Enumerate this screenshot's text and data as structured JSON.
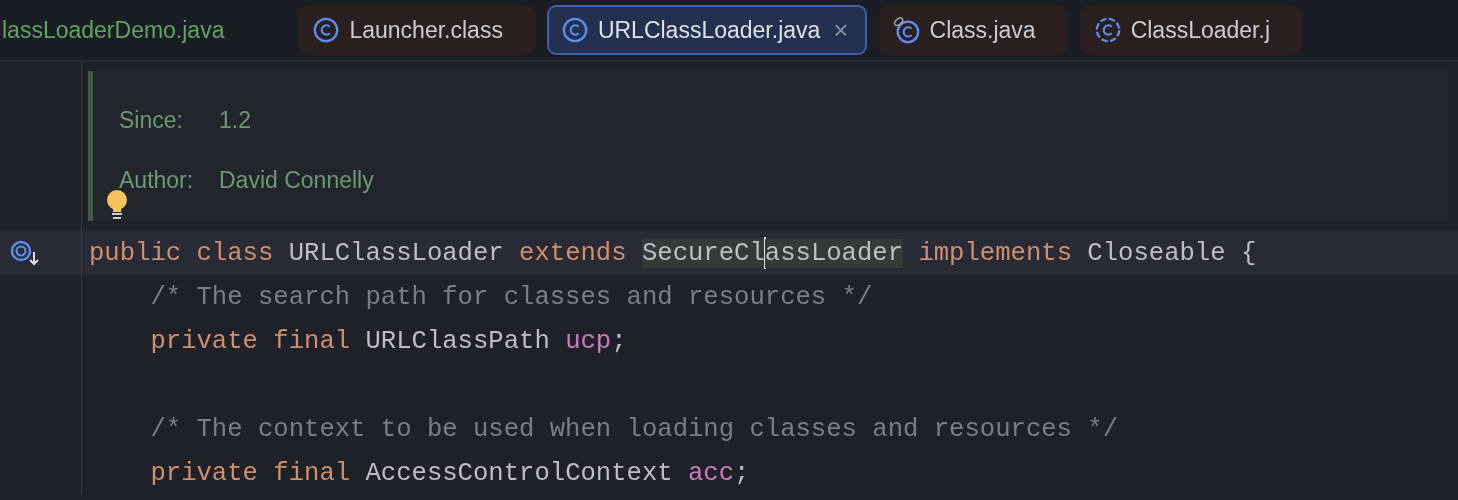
{
  "tabs": [
    {
      "label": "lassLoaderDemo.java",
      "kind": "cut",
      "color": "#5fa561",
      "tinted": false,
      "selected": false,
      "closable": false
    },
    {
      "label": "Launcher.class",
      "kind": "class",
      "color": "#c9ccd1",
      "tinted": true,
      "selected": false,
      "closable": false
    },
    {
      "label": "URLClassLoader.java",
      "kind": "class",
      "color": "#dfe1e5",
      "tinted": false,
      "selected": true,
      "closable": true
    },
    {
      "label": "Class.java",
      "kind": "pinned-class",
      "color": "#c9ccd1",
      "tinted": true,
      "selected": false,
      "closable": false
    },
    {
      "label": "ClassLoader.j",
      "kind": "abstract-class",
      "color": "#c9ccd1",
      "tinted": true,
      "selected": false,
      "closable": false
    }
  ],
  "doc": {
    "entries": [
      {
        "label": "Since:",
        "value": "1.2"
      },
      {
        "label": "Author:",
        "value": "David Connelly"
      }
    ]
  },
  "close_symbol": "×",
  "code": [
    {
      "kind": "declaration",
      "current": true,
      "tokens": [
        {
          "kind": "keyword",
          "text": "public class "
        },
        {
          "kind": "plain",
          "text": "URLClassLoader "
        },
        {
          "kind": "keyword",
          "text": "extends "
        },
        {
          "kind": "usage",
          "text": "SecureCl"
        },
        {
          "kind": "caret"
        },
        {
          "kind": "usage",
          "text": "assLoader"
        },
        {
          "kind": "keyword",
          "text": " implements "
        },
        {
          "kind": "plain",
          "text": "Closeable {"
        }
      ]
    },
    {
      "kind": "code",
      "current": false,
      "tokens": [
        {
          "kind": "comment",
          "text": "    /* The search path for classes and resources */"
        }
      ]
    },
    {
      "kind": "code",
      "current": false,
      "tokens": [
        {
          "kind": "keyword",
          "text": "    private final "
        },
        {
          "kind": "plain",
          "text": "URLClassPath "
        },
        {
          "kind": "field",
          "text": "ucp"
        },
        {
          "kind": "plain",
          "text": ";"
        }
      ]
    },
    {
      "kind": "blank",
      "current": false
    },
    {
      "kind": "code",
      "current": false,
      "tokens": [
        {
          "kind": "comment",
          "text": "    /* The context to be used when loading classes and resources */"
        }
      ]
    },
    {
      "kind": "code",
      "current": false,
      "tokens": [
        {
          "kind": "keyword",
          "text": "    private final "
        },
        {
          "kind": "plain",
          "text": "AccessControlContext "
        },
        {
          "kind": "field",
          "text": "acc"
        },
        {
          "kind": "plain",
          "text": ";"
        }
      ]
    }
  ]
}
